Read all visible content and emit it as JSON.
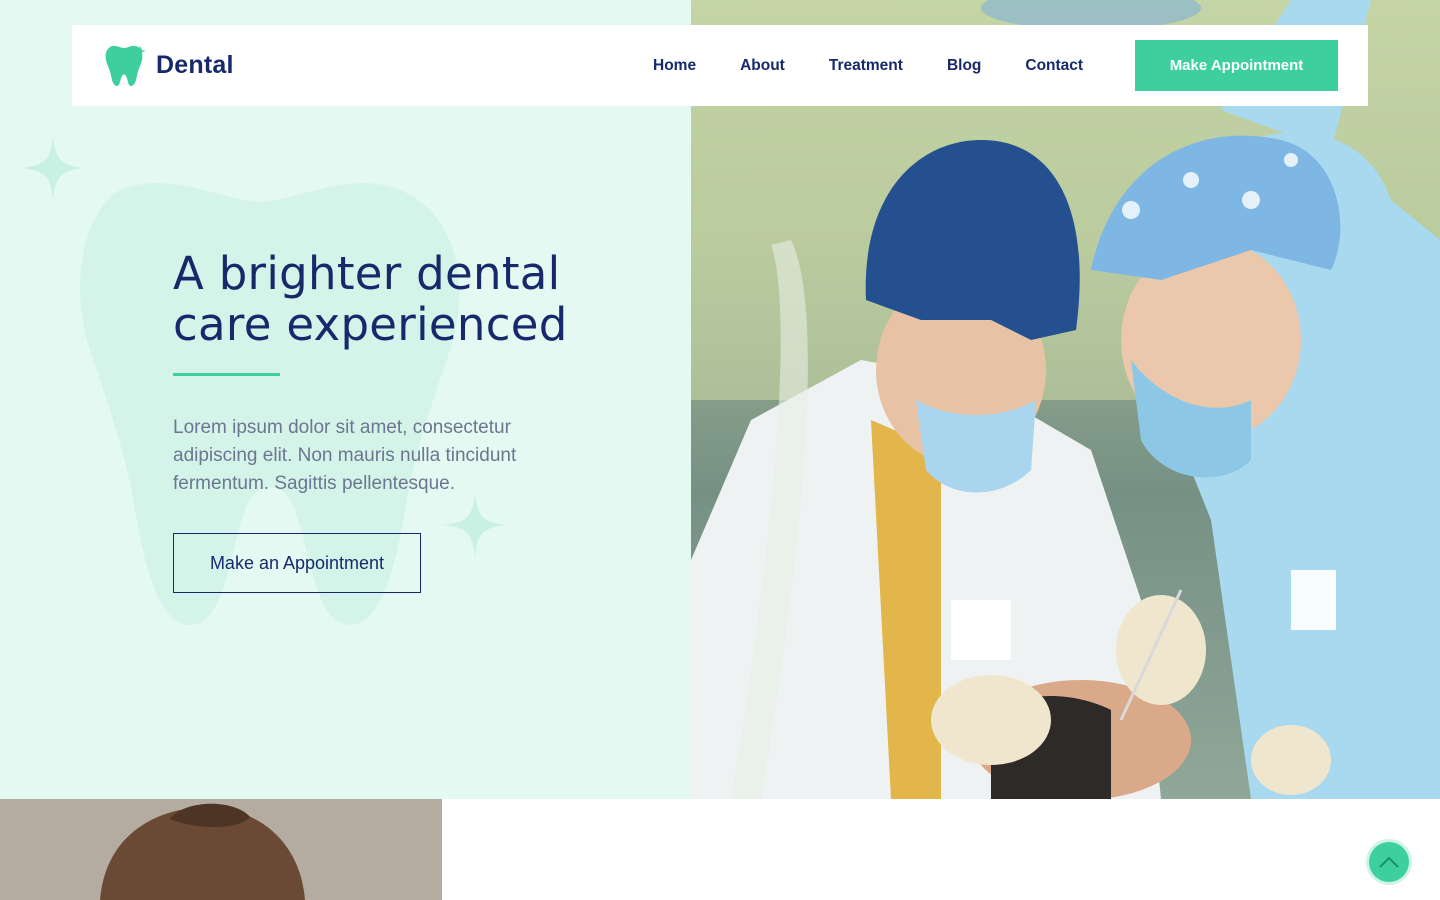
{
  "brand": {
    "name": "Dental",
    "logo_icon": "tooth-logo-icon"
  },
  "nav": {
    "links": [
      "Home",
      "About",
      "Treatment",
      "Blog",
      "Contact"
    ],
    "cta_label": "Make Appointment"
  },
  "hero": {
    "title_line1": "A brighter dental",
    "title_line2": "care experienced",
    "description": "Lorem ipsum dolor sit amet, consectetur adipiscing elit. Non mauris nulla tincidunt fermentum. Sagittis pellentesque.",
    "cta_label": "Make an Appointment",
    "photo_icon": "dentists-at-work-photo"
  },
  "scroll_top_icon": "chevron-up-icon",
  "colors": {
    "accent": "#3ecf9f",
    "navy": "#17296b",
    "hero_bg": "#e3f9f1",
    "text_muted": "#6d7690"
  }
}
